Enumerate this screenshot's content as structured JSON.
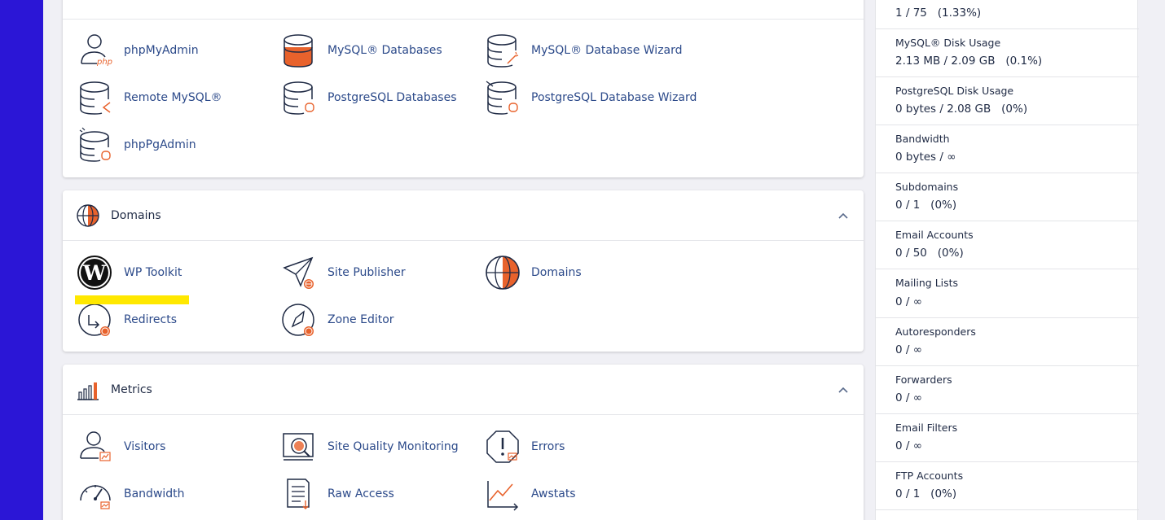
{
  "databases": {
    "items": [
      {
        "label": "phpMyAdmin",
        "icon": "phpmyadmin-icon"
      },
      {
        "label": "MySQL® Databases",
        "icon": "mysql-databases-icon"
      },
      {
        "label": "MySQL® Database Wizard",
        "icon": "mysql-wizard-icon"
      },
      {
        "label": "Remote MySQL®",
        "icon": "remote-mysql-icon"
      },
      {
        "label": "PostgreSQL Databases",
        "icon": "postgresql-databases-icon"
      },
      {
        "label": "PostgreSQL Database Wizard",
        "icon": "postgresql-wizard-icon"
      },
      {
        "label": "phpPgAdmin",
        "icon": "phppgadmin-icon"
      }
    ]
  },
  "domains": {
    "title": "Domains",
    "items": [
      {
        "label": "WP Toolkit",
        "icon": "wordpress-icon"
      },
      {
        "label": "Site Publisher",
        "icon": "site-publisher-icon"
      },
      {
        "label": "Domains",
        "icon": "globe-icon"
      },
      {
        "label": "Redirects",
        "icon": "redirects-icon"
      },
      {
        "label": "Zone Editor",
        "icon": "zone-editor-icon"
      }
    ]
  },
  "metrics": {
    "title": "Metrics",
    "items": [
      {
        "label": "Visitors",
        "icon": "visitors-icon"
      },
      {
        "label": "Site Quality Monitoring",
        "icon": "site-quality-icon"
      },
      {
        "label": "Errors",
        "icon": "errors-icon"
      },
      {
        "label": "Bandwidth",
        "icon": "bandwidth-gauge-icon"
      },
      {
        "label": "Raw Access",
        "icon": "raw-access-icon"
      },
      {
        "label": "Awstats",
        "icon": "awstats-icon"
      }
    ]
  },
  "stats": [
    {
      "label": "",
      "value": "1 / 75   (1.33%)"
    },
    {
      "label": "MySQL® Disk Usage",
      "value": "2.13 MB / 2.09 GB   (0.1%)"
    },
    {
      "label": "PostgreSQL Disk Usage",
      "value": "0 bytes / 2.08 GB   (0%)"
    },
    {
      "label": "Bandwidth",
      "value": "0 bytes / ∞"
    },
    {
      "label": "Subdomains",
      "value": "0 / 1   (0%)"
    },
    {
      "label": "Email Accounts",
      "value": "0 / 50   (0%)"
    },
    {
      "label": "Mailing Lists",
      "value": "0 / ∞"
    },
    {
      "label": "Autoresponders",
      "value": "0 / ∞"
    },
    {
      "label": "Forwarders",
      "value": "0 / ∞"
    },
    {
      "label": "Email Filters",
      "value": "0 / ∞"
    },
    {
      "label": "FTP Accounts",
      "value": "0 / 1   (0%)"
    }
  ],
  "colors": {
    "accent": "#e8622c",
    "sidebar": "#2b16d6",
    "link": "#2c4a8a",
    "highlight": "#ffe800"
  }
}
